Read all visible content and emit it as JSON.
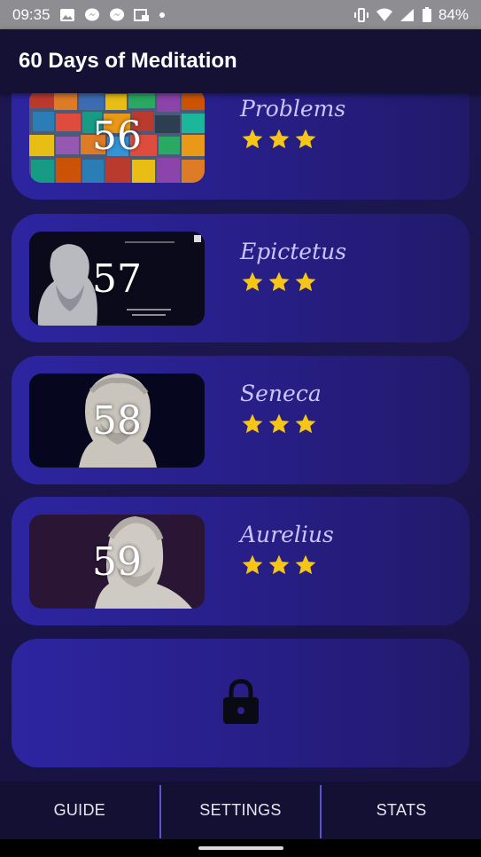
{
  "status_bar": {
    "time": "09:35",
    "battery": "84%",
    "left_icons": [
      "image-icon",
      "messenger-icon",
      "messenger-icon",
      "calendar-icon",
      "dot-icon"
    ],
    "right_icons": [
      "vibrate-icon",
      "wifi-icon",
      "signal-icon",
      "battery-icon"
    ]
  },
  "app_bar": {
    "title": "60 Days of Meditation"
  },
  "cards": [
    {
      "day": "56",
      "title": "Problems",
      "stars": 3,
      "thumb": "puzzle"
    },
    {
      "day": "57",
      "title": "Epictetus",
      "stars": 3,
      "thumb": "epictetus"
    },
    {
      "day": "58",
      "title": "Seneca",
      "stars": 3,
      "thumb": "seneca"
    },
    {
      "day": "59",
      "title": "Aurelius",
      "stars": 3,
      "thumb": "aurelius"
    }
  ],
  "locked_card": {
    "icon": "lock-icon"
  },
  "bottom_nav": {
    "guide": "GUIDE",
    "settings": "SETTINGS",
    "stats": "STATS"
  },
  "colors": {
    "star": "#f5c518",
    "accent": "#5d52d6",
    "card": "#2d25a0"
  }
}
